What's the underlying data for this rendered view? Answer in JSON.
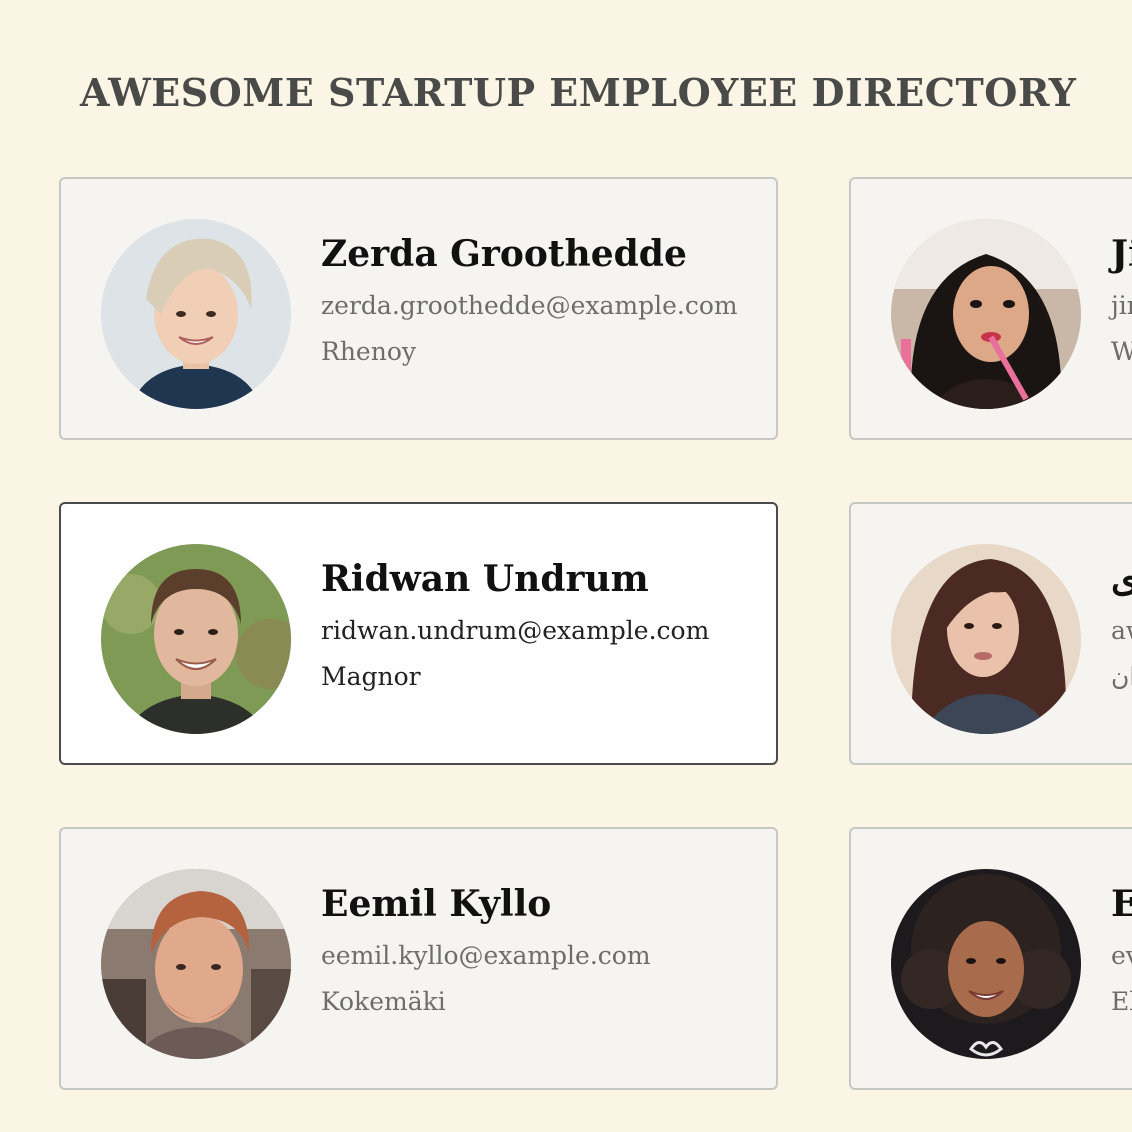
{
  "header": {
    "title": "AWESOME STARTUP EMPLOYEE DIRECTORY"
  },
  "employees": [
    {
      "name": "Zerda Groothedde",
      "email": "zerda.groothedde@example.com",
      "city": "Rhenoy",
      "avatar_icon": "woman-short-blonde-hair-photo",
      "selected": false
    },
    {
      "name": "Ji",
      "email": "jir",
      "city": "W",
      "avatar_icon": "woman-dark-hair-straw-photo",
      "selected": false
    },
    {
      "name": "Ridwan Undrum",
      "email": "ridwan.undrum@example.com",
      "city": "Magnor",
      "avatar_icon": "man-brown-hair-smiling-photo",
      "selected": true
    },
    {
      "name": "ی",
      "email": "aw",
      "city": "ان",
      "avatar_icon": "woman-long-brown-hair-photo",
      "selected": false
    },
    {
      "name": "Eemil Kyllo",
      "email": "eemil.kyllo@example.com",
      "city": "Kokemäki",
      "avatar_icon": "man-red-hair-beard-photo",
      "selected": false
    },
    {
      "name": "E",
      "email": "ev",
      "city": "El",
      "avatar_icon": "woman-curly-hair-smiling-photo",
      "selected": false
    }
  ]
}
